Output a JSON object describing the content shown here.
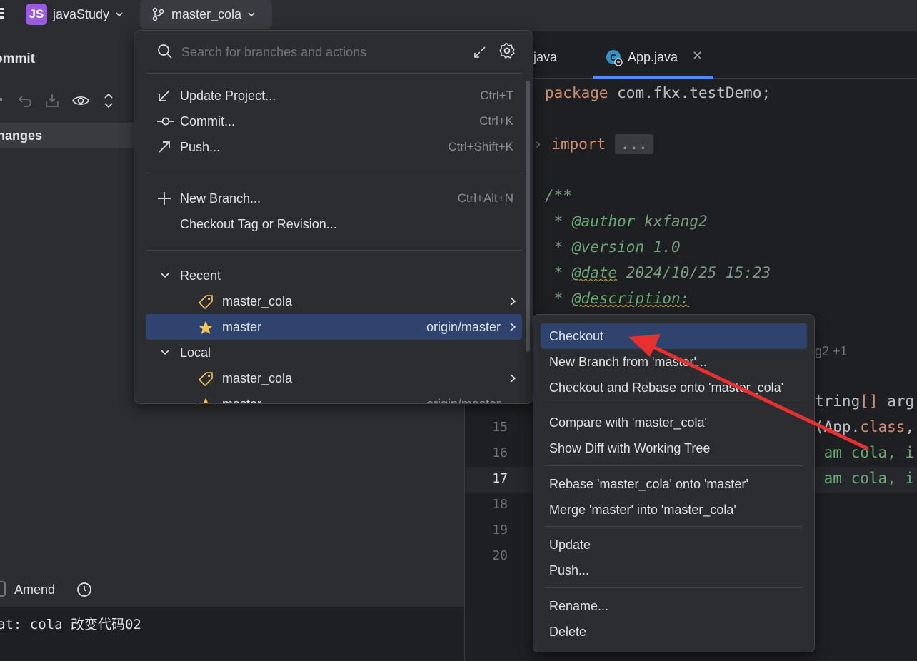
{
  "titlebar": {
    "project_badge": "JS",
    "project_name": "javaStudy",
    "branch_name": "master_cola"
  },
  "commit_panel": {
    "title": "ommit",
    "changes_label": "hanges",
    "amend_label": "Amend",
    "commit_message": "at: cola 改变代码02"
  },
  "editor": {
    "tabs": [
      {
        "label": "java"
      },
      {
        "label": "App.java"
      }
    ],
    "line_numbers": [
      "15",
      "16",
      "17",
      "18",
      "19",
      "20"
    ],
    "code": {
      "line_package_kw": "package",
      "line_package_rest": " com.fkx.testDemo;",
      "line_import_kw": "import",
      "line_import_fold": "...",
      "doc_open": "/**",
      "author_tag": "@author",
      "author_val": " kxfang2",
      "version_tag": "@version",
      "version_val": " 1.0",
      "date_tag": "@date",
      "date_val": " 2024/10/25 15:23",
      "desc_tag": "@description:",
      "hint_authors": "g2 +1",
      "main_sig_a": "tring",
      "main_sig_b": "[]",
      "main_sig_c": " arg",
      "run_line_a": "(App.",
      "run_line_kw": "class",
      "run_line_b": ",",
      "print1": " am cola, i",
      "print2": " am cola, i"
    }
  },
  "branch_popup": {
    "search_placeholder": "Search for branches and actions",
    "actions": [
      {
        "label": "Update Project...",
        "shortcut": "Ctrl+T",
        "icon": "update-arrow-icon"
      },
      {
        "label": "Commit...",
        "shortcut": "Ctrl+K",
        "icon": "commit-icon"
      },
      {
        "label": "Push...",
        "shortcut": "Ctrl+Shift+K",
        "icon": "push-arrow-icon"
      },
      {
        "label": "New Branch...",
        "shortcut": "Ctrl+Alt+N",
        "icon": "plus-icon"
      },
      {
        "label": "Checkout Tag or Revision...",
        "shortcut": ""
      }
    ],
    "recent_label": "Recent",
    "local_label": "Local",
    "recent_branches": [
      {
        "name": "master_cola",
        "icon": "tag-icon",
        "tracking": ""
      },
      {
        "name": "master",
        "icon": "star-icon",
        "tracking": "origin/master"
      }
    ],
    "local_branches": [
      {
        "name": "master_cola",
        "icon": "tag-icon",
        "tracking": ""
      },
      {
        "name": "master",
        "icon": "star-icon",
        "tracking": "origin/master"
      }
    ]
  },
  "context_menu": {
    "items": [
      "Checkout",
      "New Branch from 'master'...",
      "Checkout and Rebase onto 'master_cola'",
      "Compare with 'master_cola'",
      "Show Diff with Working Tree",
      "Rebase 'master_cola' onto 'master'",
      "Merge 'master' into 'master_cola'",
      "Update",
      "Push...",
      "Rename...",
      "Delete"
    ]
  },
  "colors": {
    "accent": "#548af7",
    "selection": "#2e436e",
    "annotation_arrow": "#e8302f",
    "star": "#f2c55c"
  }
}
